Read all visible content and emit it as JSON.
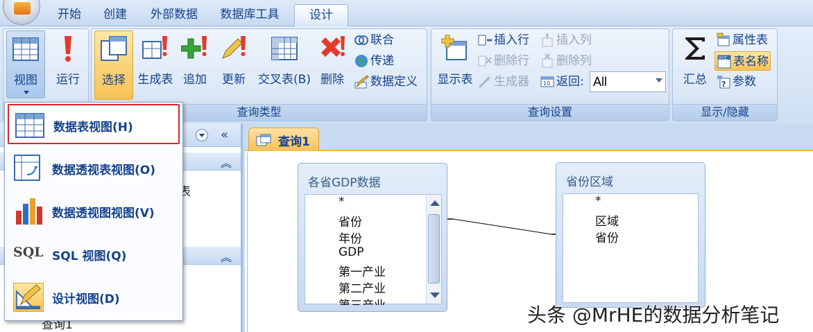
{
  "tabs": [
    "开始",
    "创建",
    "外部数据",
    "数据库工具",
    "设计"
  ],
  "ribbon": {
    "results": {
      "view": "视图",
      "run": "运行"
    },
    "query_type": {
      "label": "查询类型",
      "select": "选择",
      "make_table": "生成表",
      "append": "追加",
      "update": "更新",
      "crosstab": "交叉表(B)",
      "delete": "删除",
      "union": "联合",
      "pass_through": "传递",
      "data_definition": "数据定义"
    },
    "query_setup": {
      "label": "查询设置",
      "show_table": "显示表",
      "insert_rows": "插入行",
      "delete_rows": "删除行",
      "builder": "生成器",
      "insert_columns": "插入列",
      "delete_columns": "删除列",
      "return_label": "返回:",
      "return_value": "All"
    },
    "show_hide": {
      "label": "显示/隐藏",
      "totals": "汇总",
      "property_sheet": "属性表",
      "table_names": "表名称",
      "parameters": "参数"
    }
  },
  "view_menu": {
    "items": [
      "数据表视图(H)",
      "数据透视表视图(O)",
      "数据透视图视图(V)",
      "SQL 视图(Q)",
      "设计视图(D)"
    ]
  },
  "nav": {
    "partial_text_1": "表",
    "partial_text_2": "查询1"
  },
  "document": {
    "tab_label": "查询1",
    "tables": [
      {
        "title": "各省GDP数据",
        "fields": [
          "*",
          "省份",
          "年份",
          "GDP",
          "第一产业",
          "第二产业",
          "第三产业"
        ]
      },
      {
        "title": "省份区域",
        "fields": [
          "*",
          "区域",
          "省份"
        ]
      }
    ]
  },
  "watermark": "头条 @MrHE的数据分析笔记",
  "colors": {
    "accent": "#f8c253",
    "highlight_border": "#d7262b",
    "ribbon_text": "#15428b"
  }
}
